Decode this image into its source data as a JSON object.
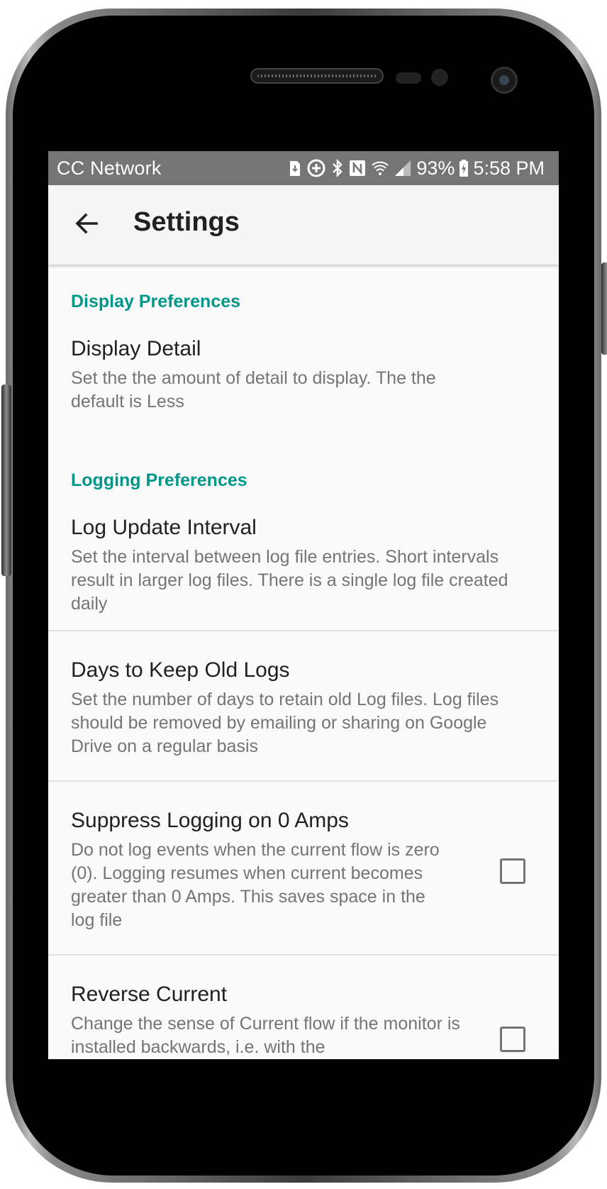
{
  "status_bar": {
    "carrier": "CC Network",
    "battery_percent": "93%",
    "time": "5:58 PM",
    "icons": [
      "sim-update-icon",
      "add-circle-icon",
      "bluetooth-icon",
      "nfc-icon",
      "wifi-icon",
      "signal-icon",
      "battery-charging-icon"
    ]
  },
  "app_bar": {
    "back_icon": "arrow-back-icon",
    "title": "Settings"
  },
  "sections": [
    {
      "category": "Display Preferences",
      "items": [
        {
          "title": "Display Detail",
          "summary": "Set the the amount of detail to display. The the default is Less"
        }
      ]
    },
    {
      "category": "Logging Preferences",
      "items": [
        {
          "title": "Log Update Interval",
          "summary": "Set the interval between log file entries. Short intervals result in larger log files. There is  a single log file created daily"
        },
        {
          "title": "Days to Keep Old Logs",
          "summary": "Set the number of days to retain old Log files. Log files should be removed by emailing or sharing on Google Drive on a regular basis"
        },
        {
          "title": "Suppress Logging on 0 Amps",
          "summary": "Do not log events when the current flow is zero (0). Logging resumes when current becomes greater than 0 Amps. This saves space in the log file",
          "checked": false
        },
        {
          "title": "Reverse Current",
          "summary": "Change the sense of Current flow if the monitor is installed backwards, i.e. with the",
          "checked": false
        }
      ]
    }
  ],
  "colors": {
    "accent": "#009688",
    "status_bar": "#757575",
    "app_bar": "#f5f5f5",
    "background": "#fafafa",
    "title_text": "#212121",
    "summary_text": "#757575"
  }
}
